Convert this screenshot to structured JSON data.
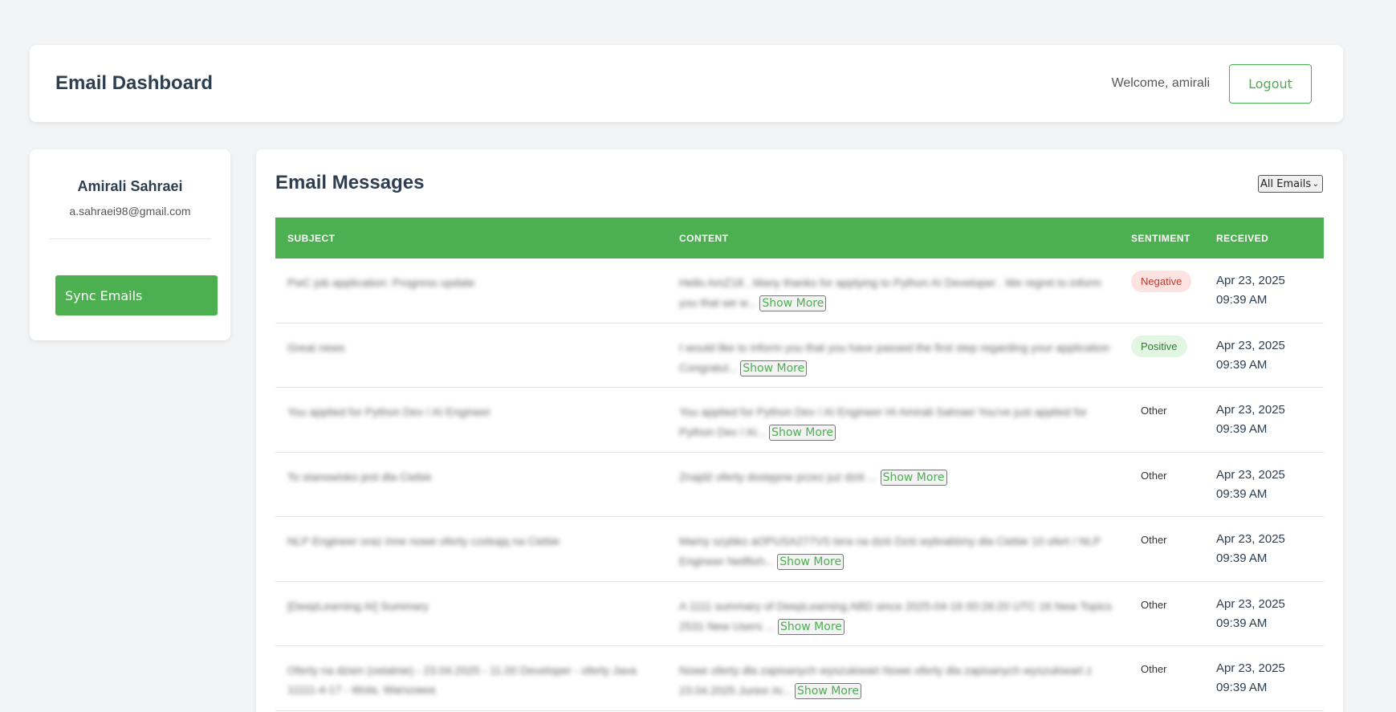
{
  "header": {
    "title": "Email Dashboard",
    "welcome": "Welcome, amirali",
    "logout_label": "Logout"
  },
  "sidebar": {
    "name": "Amirali Sahraei",
    "email": "a.sahraei98@gmail.com",
    "sync_label": "Sync Emails"
  },
  "main": {
    "title": "Email Messages",
    "filter_selected": "All Emails",
    "columns": [
      "SUBJECT",
      "CONTENT",
      "SENTIMENT",
      "RECEIVED"
    ],
    "show_more_label": "Show More",
    "rows": [
      {
        "subject": "PwC job application: Progress update",
        "content": "Hello AmZ18 , Many thanks for applying to Python AI Developer . We regret to inform you that we w...",
        "sentiment": "Negative",
        "sentiment_class": "negative",
        "date": "Apr 23, 2025",
        "time": "09:39 AM"
      },
      {
        "subject": "Great news",
        "content": "I would like to inform you that you have passed the first step regarding your application Congratul...",
        "sentiment": "Positive",
        "sentiment_class": "positive",
        "date": "Apr 23, 2025",
        "time": "09:39 AM"
      },
      {
        "subject": "You applied for Python Dev / AI Engineer",
        "content": "You applied for Python Dev / AI Engineer Hi Amirali Sahraei You've just applied for Python Dev / AI...",
        "sentiment": "Other",
        "sentiment_class": "other",
        "date": "Apr 23, 2025",
        "time": "09:39 AM"
      },
      {
        "subject": "To stanowisko jest dla Ciebie",
        "content": "Znajdź oferty dostępne przez już dziś ...",
        "sentiment": "Other",
        "sentiment_class": "other",
        "date": "Apr 23, 2025",
        "time": "09:39 AM"
      },
      {
        "subject": "NLP Engineer oraz inne nowe oferty czekają na Ciebie",
        "content": "Mamy szybko aOPUSA277VS tera na dziś Dziś wybraliśmy dla Ciebie 10 ofert / NLP Engineer Netflixh...",
        "sentiment": "Other",
        "sentiment_class": "other",
        "date": "Apr 23, 2025",
        "time": "09:39 AM"
      },
      {
        "subject": "[DeepLearning AI] Summary",
        "content": "A 1111 summary of DeepLearning ABD since 2025-04-16 00:26:20 UTC 16 New Topics 2531 New Users ...",
        "sentiment": "Other",
        "sentiment_class": "other",
        "date": "Apr 23, 2025",
        "time": "09:39 AM"
      },
      {
        "subject": "Oferty na dzien (ostatnie) - 23.04.2025 - 11.00 Developer - oferty Java 11111-4-17 - Wola, Warszawa",
        "content": "Nowe oferty dla zapisanych wyszukiwań Nowe oferty dla zapisanych wyszukiwań z 23.04.2025 Junior Ar...",
        "sentiment": "Other",
        "sentiment_class": "other",
        "date": "Apr 23, 2025",
        "time": "09:39 AM"
      }
    ]
  }
}
